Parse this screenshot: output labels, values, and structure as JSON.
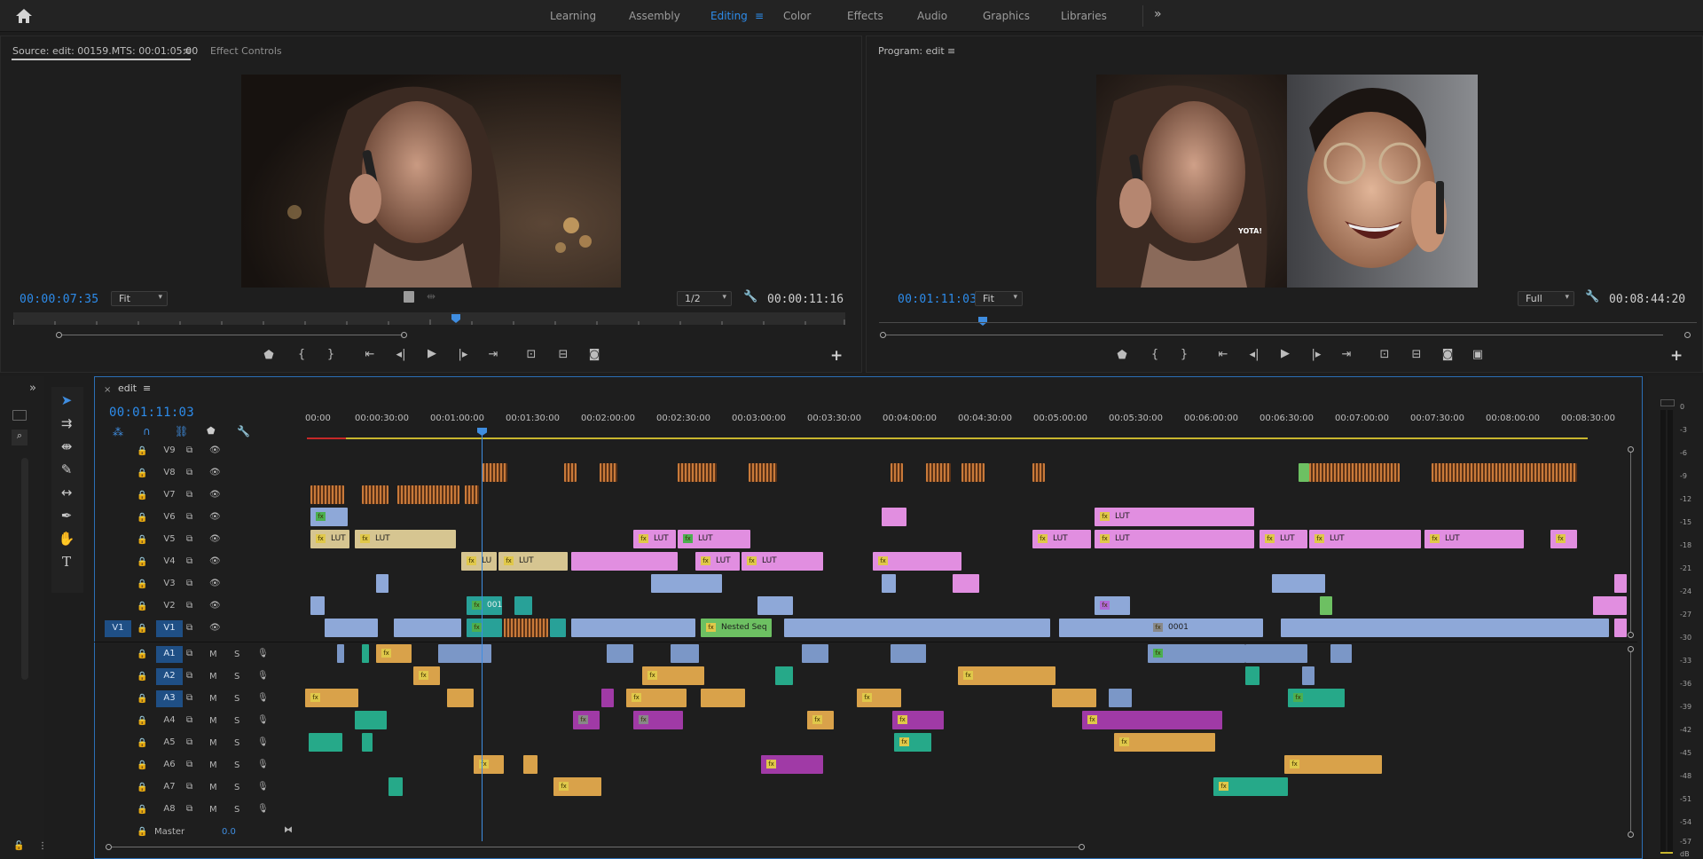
{
  "workspaces": {
    "items": [
      "Learning",
      "Assembly",
      "Editing",
      "Color",
      "Effects",
      "Audio",
      "Graphics",
      "Libraries"
    ],
    "active": "Editing",
    "more": "»"
  },
  "source_monitor": {
    "tab": "Source: edit: 00159.MTS: 00:01:05:00",
    "tab2": "Effect Controls",
    "timecode": "00:00:07:35",
    "fit": "Fit",
    "resolution": "1/2",
    "duration": "00:00:11:16"
  },
  "program_monitor": {
    "tab": "Program: edit",
    "timecode": "00:01:11:03",
    "fit": "Fit",
    "resolution": "Full",
    "duration": "00:08:44:20",
    "subtitle_text": "YOTA!"
  },
  "timeline": {
    "sequence_name": "edit",
    "timecode": "00:01:11:03",
    "ruler_ticks": [
      "00:00",
      "00:00:30:00",
      "00:01:00:00",
      "00:01:30:00",
      "00:02:00:00",
      "00:02:30:00",
      "00:03:00:00",
      "00:03:30:00",
      "00:04:00:00",
      "00:04:30:00",
      "00:05:00:00",
      "00:05:30:00",
      "00:06:00:00",
      "00:06:30:00",
      "00:07:00:00",
      "00:07:30:00",
      "00:08:00:00",
      "00:08:30:00"
    ],
    "video_tracks": [
      "V9",
      "V8",
      "V7",
      "V6",
      "V5",
      "V4",
      "V3",
      "V2",
      "V1"
    ],
    "audio_tracks": [
      "A1",
      "A2",
      "A3",
      "A4",
      "A5",
      "A6",
      "A7",
      "A8"
    ],
    "source_patch": "V1",
    "mute_label": "M",
    "solo_label": "S",
    "master_label": "Master",
    "master_value": "0.0",
    "clip_labels": {
      "lut": "LUT",
      "lu": "LU",
      "nested": "Nested Seq",
      "n001": "001",
      "n0001": "0001",
      "fx": "fx"
    }
  },
  "meters": {
    "scale": [
      "0",
      "-3",
      "-6",
      "-9",
      "-12",
      "-15",
      "-18",
      "-21",
      "-24",
      "-27",
      "-30",
      "-33",
      "-36",
      "-39",
      "-42",
      "-45",
      "-48",
      "-51",
      "-54",
      "-57",
      "dB"
    ]
  },
  "colors": {
    "accent": "#2d8ceb",
    "video_clip": "#8ea8d8",
    "adjustment_clip": "#e18ee0",
    "audio_clip": "#d9a24a"
  }
}
